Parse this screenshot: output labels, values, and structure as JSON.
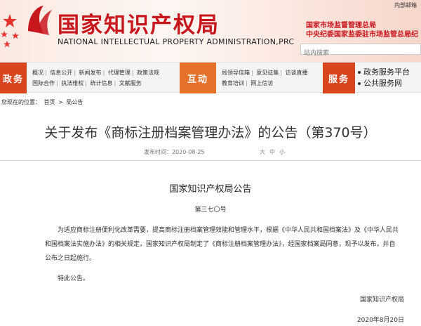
{
  "header": {
    "internal_mail": "内部邮箱",
    "cn_title": "国家知识产权局",
    "en_title": "NATIONAL INTELLECTUAL PROPERTY ADMINISTRATION,PRC",
    "samr_line1": "国家市场监督管理总局",
    "samr_line2": "中央纪委国家监委驻市场监管总局纪",
    "search_placeholder": "站内搜索"
  },
  "nav": {
    "gov": {
      "label": "政务",
      "row1": [
        "概况",
        "信息公开",
        "新闻发布",
        "代理管理",
        "政策法规"
      ],
      "row2": [
        "国际合作",
        "执法维权",
        "统计信息",
        "文献服务"
      ]
    },
    "interact": {
      "label": "互动",
      "row1": [
        "局领导信箱",
        "意见征集",
        "访谈直播"
      ],
      "row2": [
        "教育培训",
        "网上信访"
      ]
    },
    "service": {
      "label": "服务",
      "items": [
        "政务服务平台",
        "公共服务网"
      ]
    }
  },
  "breadcrumb": {
    "current_label": "您现在的位置：",
    "home": "首页",
    "arrow": ">",
    "section": "局公告"
  },
  "article": {
    "title": "关于发布《商标注册档案管理办法》的公告（第370号）",
    "published_label": "发布时间：",
    "published_date": "2020-08-25",
    "font_sizes": "大中小",
    "doc_head": "国家知识产权局公告",
    "doc_number": "第三七〇号",
    "body_line1": "为适应商标注册便利化改革需要，提高商标注册档案管理效能和管理水平，根据《中华人民共和国档案法》及《中华人民共",
    "body_line2": "和国档案法实施办法》的相关规定，国家知识产权局制定了《商标注册档案管理办法》，经国家档案局同意，现予以发布，并自",
    "body_line3": "公布之日起施行。",
    "closing": "特此公告。",
    "signature": "国家知识产权局",
    "sign_date": "2020年8月20日"
  },
  "colors": {
    "brand_red": "#c8161d",
    "nav_red": "#d9451d",
    "nav_orange": "#e4722b"
  }
}
